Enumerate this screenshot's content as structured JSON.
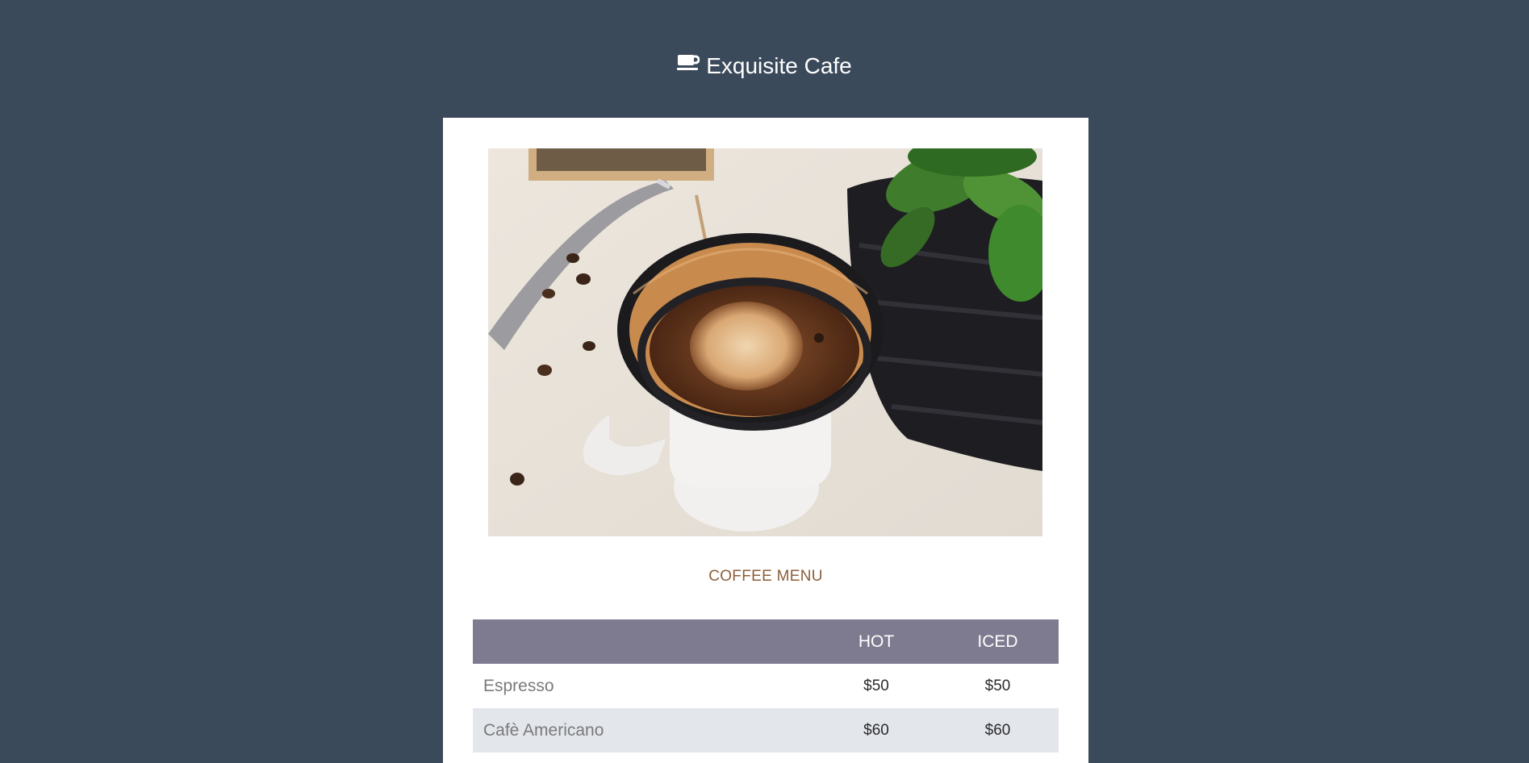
{
  "header": {
    "icon": "coffee-cup-icon",
    "title": "Exquisite Cafe"
  },
  "hero_image": {
    "description_icon": "pour-over-coffee-photo"
  },
  "menu": {
    "title": "COFFEE MENU",
    "columns": [
      "",
      "HOT",
      "ICED"
    ],
    "rows": [
      {
        "name": "Espresso",
        "hot": "$50",
        "iced": "$50"
      },
      {
        "name": "Cafè Americano",
        "hot": "$60",
        "iced": "$60"
      }
    ]
  },
  "colors": {
    "background": "#3b4a5b",
    "card": "#ffffff",
    "accent": "#8c5e3a",
    "table_header": "#7e7b90",
    "row_alt": "#e3e6eb"
  }
}
